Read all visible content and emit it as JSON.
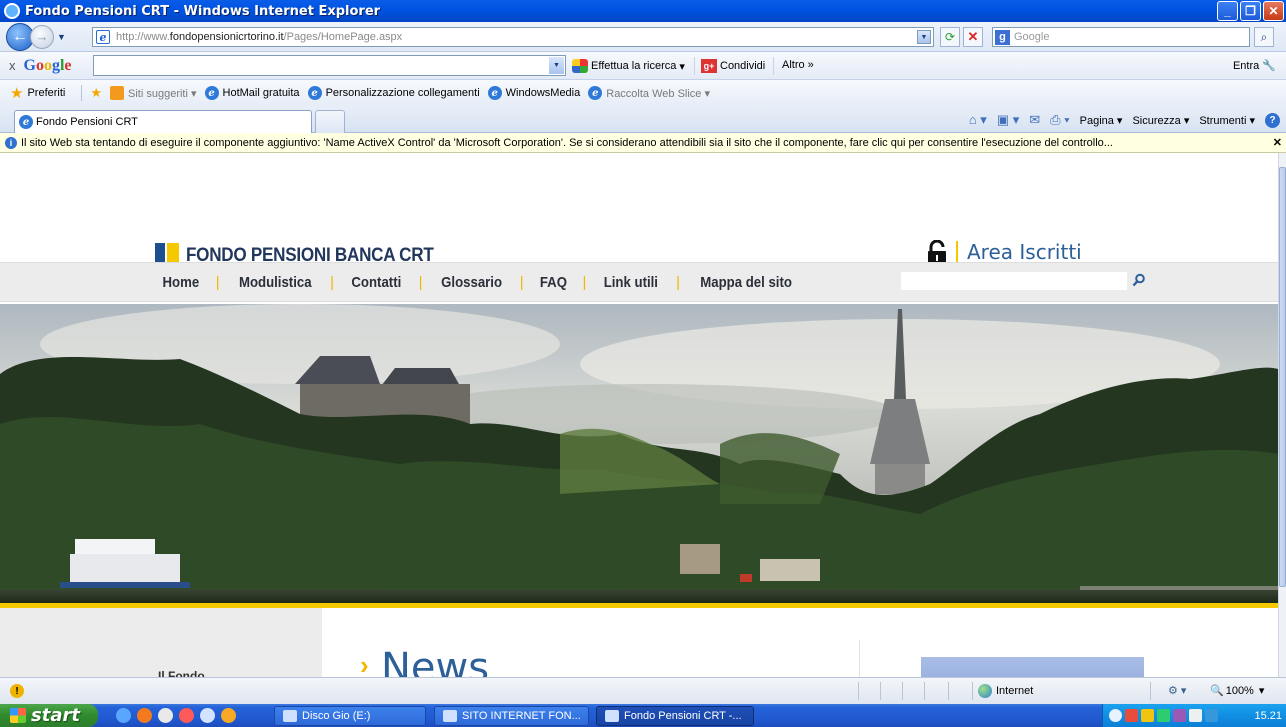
{
  "window": {
    "title": "Fondo Pensioni CRT - Windows Internet Explorer"
  },
  "address": {
    "url_prefix": "http://www.",
    "url_domain": "fondopensionicrtorino.it",
    "url_path": "/Pages/HomePage.aspx",
    "search_placeholder": "Google"
  },
  "google_toolbar": {
    "close": "x",
    "logo": "Google",
    "search_label": "Effettua la ricerca",
    "share_label": "Condividi",
    "more_label": "Altro »",
    "signin_label": "Entra"
  },
  "favorites": {
    "label": "Preferiti",
    "items": [
      {
        "label": "Siti suggeriti ▾"
      },
      {
        "label": "HotMail gratuita"
      },
      {
        "label": "Personalizzazione collegamenti"
      },
      {
        "label": "WindowsMedia"
      },
      {
        "label": "Raccolta Web Slice ▾"
      }
    ]
  },
  "tabs": {
    "active": "Fondo Pensioni CRT"
  },
  "commands": {
    "page": "Pagina ▾",
    "security": "Sicurezza ▾",
    "tools": "Strumenti ▾"
  },
  "infobar": {
    "message": "Il sito Web sta tentando di eseguire il componente aggiuntivo: 'Name ActiveX Control' da 'Microsoft Corporation'. Se si considerano attendibili sia il sito che il componente, fare clic qui per consentire l'esecuzione del controllo..."
  },
  "site": {
    "logo_text": "FONDO PENSIONI BANCA CRT",
    "area_label": "Area Iscritti",
    "nav": [
      "Home",
      "Modulistica",
      "Contatti",
      "Glossario",
      "FAQ",
      "Link utili",
      "Mappa del sito"
    ],
    "side_label": "Il Fondo",
    "news_title": "News",
    "colors": {
      "accent_yellow": "#f6c800",
      "brand_blue": "#2d5f99",
      "logo_navy": "#22375c"
    }
  },
  "status": {
    "zone": "Internet",
    "zoom": "100%"
  },
  "taskbar": {
    "start": "start",
    "tasks": [
      "Disco Gio (E:)",
      "SITO INTERNET FON...",
      "Fondo Pensioni CRT -..."
    ],
    "clock": "15.21"
  }
}
